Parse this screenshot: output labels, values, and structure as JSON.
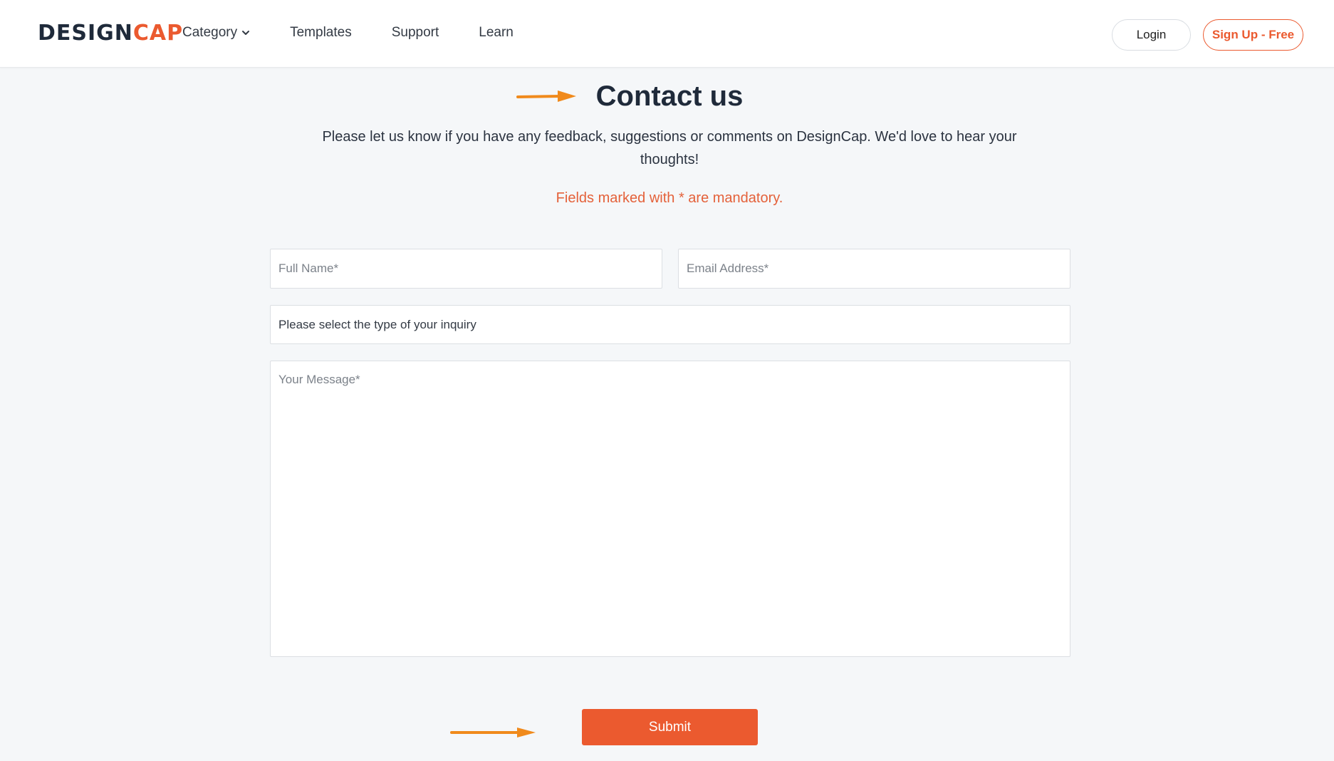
{
  "brand": {
    "logo_part1": "DESIGN",
    "logo_part2": "CAP",
    "accent_color": "#eb5a2f"
  },
  "nav": {
    "items": [
      {
        "label": "Category",
        "has_dropdown": true
      },
      {
        "label": "Templates"
      },
      {
        "label": "Support"
      },
      {
        "label": "Learn"
      }
    ],
    "login_label": "Login",
    "signup_label": "Sign Up - Free"
  },
  "contact": {
    "title": "Contact us",
    "description": "Please let us know if you have any feedback, suggestions or comments on DesignCap. We'd love to hear your thoughts!",
    "mandatory_note": "Fields marked with * are mandatory."
  },
  "form": {
    "full_name_placeholder": "Full Name*",
    "email_placeholder": "Email Address*",
    "inquiry_select_value": "Please select the type of your inquiry",
    "message_placeholder": "Your Message*",
    "submit_label": "Submit"
  },
  "annotations": {
    "arrow_color": "#f08a1c"
  },
  "icons": {
    "category_dropdown": "chevron-down-icon",
    "title_arrow": "arrow-right-icon",
    "submit_arrow": "arrow-right-icon"
  }
}
